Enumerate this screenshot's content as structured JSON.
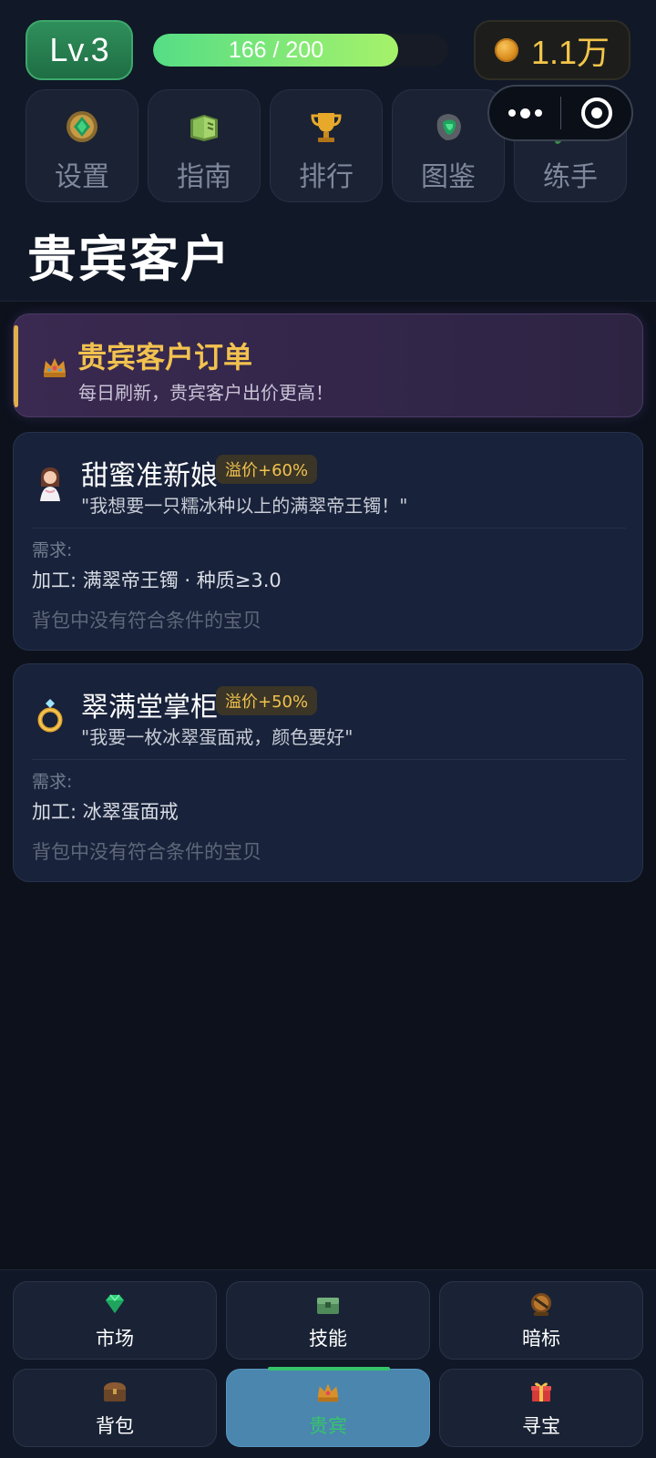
{
  "header": {
    "level": "Lv.3",
    "xp_text": "166 / 200",
    "xp_progress": 0.83,
    "coins": "1.1万"
  },
  "menu": [
    {
      "label": "设置",
      "icon": "settings-jade-icon"
    },
    {
      "label": "指南",
      "icon": "guide-book-icon"
    },
    {
      "label": "排行",
      "icon": "trophy-icon"
    },
    {
      "label": "图鉴",
      "icon": "gem-catalog-icon"
    },
    {
      "label": "练手",
      "icon": "carving-knife-icon"
    }
  ],
  "capsule": {
    "more_icon": "more-dots-icon",
    "close_icon": "target-icon"
  },
  "page": {
    "title": "贵宾客户"
  },
  "banner": {
    "title": "贵宾客户订单",
    "subtitle": "每日刷新，贵宾客户出价更高！",
    "icon": "crown-icon"
  },
  "orders": [
    {
      "name": "甜蜜准新娘",
      "badge": "溢价+60%",
      "quote": "\"我想要一只糯冰种以上的满翠帝王镯！\"",
      "req_label": "需求:",
      "requirement": "加工: 满翠帝王镯 · 种质≥3.0",
      "status": "背包中没有符合条件的宝贝",
      "avatar": "bride-avatar-icon"
    },
    {
      "name": "翠满堂掌柜",
      "badge": "溢价+50%",
      "quote": "\"我要一枚冰翠蛋面戒，颜色要好\"",
      "req_label": "需求:",
      "requirement": "加工: 冰翠蛋面戒",
      "status": "背包中没有符合条件的宝贝",
      "avatar": "ring-icon"
    }
  ],
  "nav": [
    {
      "label": "市场",
      "icon": "diamond-icon",
      "active": false
    },
    {
      "label": "技能",
      "icon": "jade-chest-icon",
      "active": false
    },
    {
      "label": "暗标",
      "icon": "bid-orb-icon",
      "active": false
    },
    {
      "label": "背包",
      "icon": "backpack-chest-icon",
      "active": false
    },
    {
      "label": "贵宾",
      "icon": "crown-icon",
      "active": true
    },
    {
      "label": "寻宝",
      "icon": "gift-icon",
      "active": false
    }
  ],
  "colors": {
    "accent_green": "#36c46c",
    "gold": "#f2c24f",
    "active_tab": "#4a86ae",
    "background": "#0c111c"
  }
}
